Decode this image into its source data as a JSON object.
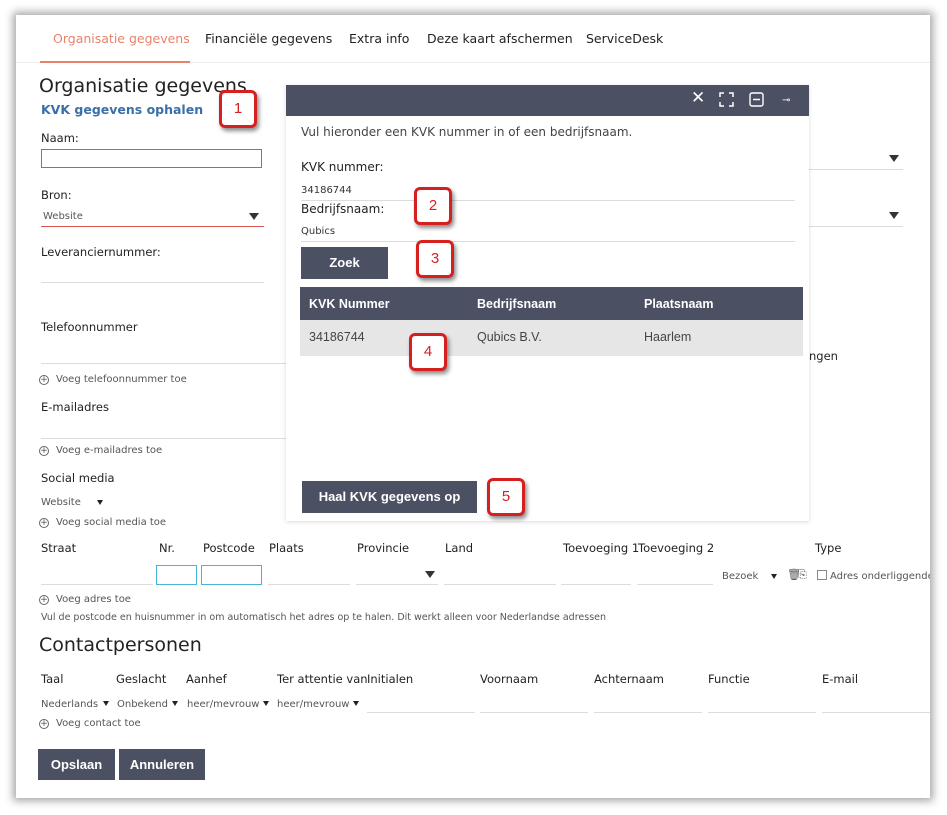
{
  "tabs": [
    {
      "label": "Organisatie gegevens",
      "active": true
    },
    {
      "label": "Financiële gegevens"
    },
    {
      "label": "Extra info"
    },
    {
      "label": "Deze kaart afschermen"
    },
    {
      "label": "ServiceDesk"
    }
  ],
  "org": {
    "title": "Organisatie gegevens",
    "kvk_link": "KVK gegevens ophalen",
    "naam_label": "Naam:",
    "naam_value": "",
    "bron_label": "Bron:",
    "bron_value": "Website",
    "leverancier_label": "Leveranciernummer:",
    "telefoon_label": "Telefoonnummer",
    "add_phone": "Voeg telefoonnummer toe",
    "email_label": "E-mailadres",
    "add_email": "Voeg e-mailadres toe",
    "social_label": "Social media",
    "social_value": "Website",
    "add_social": "Voeg social media toe",
    "right_partial_label": "ngen"
  },
  "address": {
    "columns": [
      "Straat",
      "Nr.",
      "Postcode",
      "Plaats",
      "Provincie",
      "Land",
      "Toevoeging 1",
      "Toevoeging 2",
      "Type"
    ],
    "type_value": "Bezoek",
    "checkbox_label": "Adres onderliggende",
    "add_address": "Voeg adres toe",
    "hint": "Vul de postcode en huisnummer in om automatisch het adres op te halen. Dit werkt alleen voor Nederlandse adressen"
  },
  "contacts": {
    "title": "Contactpersonen",
    "columns": [
      "Taal",
      "Geslacht",
      "Aanhef",
      "Ter attentie van",
      "Initialen",
      "Voornaam",
      "Achternaam",
      "Functie",
      "E-mail"
    ],
    "taal": "Nederlands",
    "geslacht": "Onbekend",
    "aanhef": "heer/mevrouw",
    "ter_attentie": "heer/mevrouw",
    "add_contact": "Voeg contact toe"
  },
  "buttons": {
    "save": "Opslaan",
    "cancel": "Annuleren"
  },
  "modal": {
    "instructions": "Vul hieronder een KVK nummer in of een bedrijfsnaam.",
    "kvk_label": "KVK nummer:",
    "kvk_value": "34186744",
    "bedrijf_label": "Bedrijfsnaam:",
    "bedrijf_value": "Qubics",
    "search_button": "Zoek",
    "table_headers": [
      "KVK Nummer",
      "Bedrijfsnaam",
      "Plaatsnaam"
    ],
    "rows": [
      [
        "34186744",
        "Qubics B.V.",
        "Haarlem"
      ]
    ],
    "fetch_button": "Haal KVK gegevens op"
  },
  "callouts": [
    "1",
    "2",
    "3",
    "4",
    "5"
  ],
  "icons": [
    "close-icon",
    "maximize-icon",
    "minimize-icon",
    "pin-icon",
    "trash-icon",
    "copy-icon",
    "plus-circle-icon",
    "dropdown-arrow-icon"
  ],
  "colors": {
    "accent": "#e8836a",
    "link": "#3a6fa8",
    "dark": "#4b5063",
    "error": "#d9534f",
    "callout": "#d61f1f"
  }
}
